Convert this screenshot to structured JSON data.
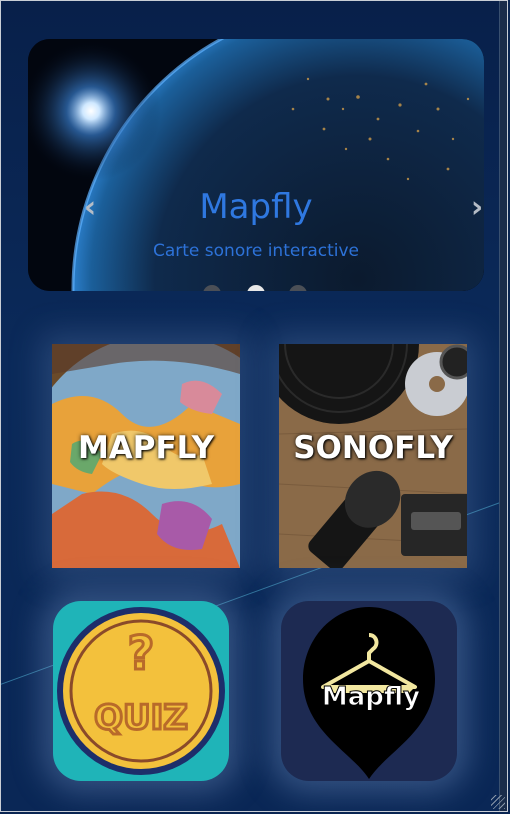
{
  "hero": {
    "title": "Mapfly",
    "subtitle": "Carte sonore interactive",
    "prev_icon": "chevron-left-icon",
    "next_icon": "chevron-right-icon",
    "slide_count": 3,
    "active_slide": 2
  },
  "tiles": [
    {
      "label": "MAPFLY",
      "image": "globe-map-photo"
    },
    {
      "label": "SONOFLY",
      "image": "vinyl-microphone-photo"
    }
  ],
  "apps": [
    {
      "name": "quiz",
      "badge_text": "QUIZ",
      "icon": "quiz-coin-icon",
      "bg": "#1fb4b8"
    },
    {
      "name": "mapfly",
      "badge_text": "Mapfly",
      "icon": "hanger-pin-icon",
      "bg": "#1d2a52"
    }
  ],
  "colors": {
    "accent": "#2f78e0",
    "background": "#0a2552"
  }
}
